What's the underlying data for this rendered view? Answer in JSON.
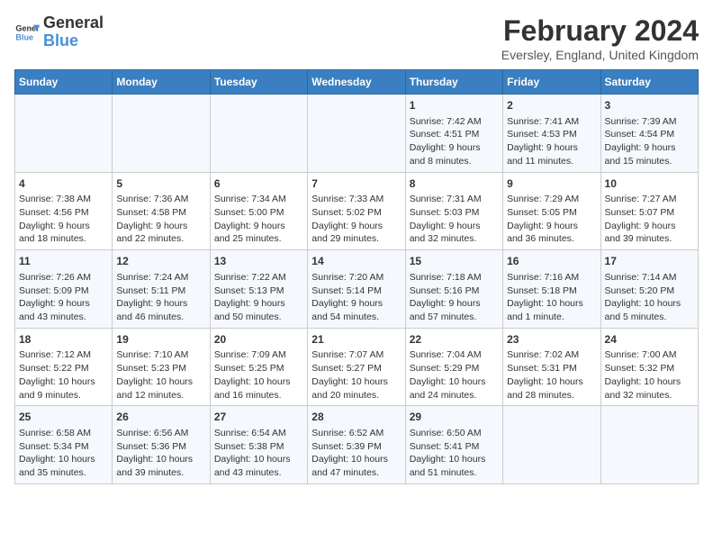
{
  "header": {
    "logo_line1": "General",
    "logo_line2": "Blue",
    "title": "February 2024",
    "subtitle": "Eversley, England, United Kingdom"
  },
  "days_of_week": [
    "Sunday",
    "Monday",
    "Tuesday",
    "Wednesday",
    "Thursday",
    "Friday",
    "Saturday"
  ],
  "weeks": [
    [
      {
        "day": "",
        "info": ""
      },
      {
        "day": "",
        "info": ""
      },
      {
        "day": "",
        "info": ""
      },
      {
        "day": "",
        "info": ""
      },
      {
        "day": "1",
        "info": "Sunrise: 7:42 AM\nSunset: 4:51 PM\nDaylight: 9 hours\nand 8 minutes."
      },
      {
        "day": "2",
        "info": "Sunrise: 7:41 AM\nSunset: 4:53 PM\nDaylight: 9 hours\nand 11 minutes."
      },
      {
        "day": "3",
        "info": "Sunrise: 7:39 AM\nSunset: 4:54 PM\nDaylight: 9 hours\nand 15 minutes."
      }
    ],
    [
      {
        "day": "4",
        "info": "Sunrise: 7:38 AM\nSunset: 4:56 PM\nDaylight: 9 hours\nand 18 minutes."
      },
      {
        "day": "5",
        "info": "Sunrise: 7:36 AM\nSunset: 4:58 PM\nDaylight: 9 hours\nand 22 minutes."
      },
      {
        "day": "6",
        "info": "Sunrise: 7:34 AM\nSunset: 5:00 PM\nDaylight: 9 hours\nand 25 minutes."
      },
      {
        "day": "7",
        "info": "Sunrise: 7:33 AM\nSunset: 5:02 PM\nDaylight: 9 hours\nand 29 minutes."
      },
      {
        "day": "8",
        "info": "Sunrise: 7:31 AM\nSunset: 5:03 PM\nDaylight: 9 hours\nand 32 minutes."
      },
      {
        "day": "9",
        "info": "Sunrise: 7:29 AM\nSunset: 5:05 PM\nDaylight: 9 hours\nand 36 minutes."
      },
      {
        "day": "10",
        "info": "Sunrise: 7:27 AM\nSunset: 5:07 PM\nDaylight: 9 hours\nand 39 minutes."
      }
    ],
    [
      {
        "day": "11",
        "info": "Sunrise: 7:26 AM\nSunset: 5:09 PM\nDaylight: 9 hours\nand 43 minutes."
      },
      {
        "day": "12",
        "info": "Sunrise: 7:24 AM\nSunset: 5:11 PM\nDaylight: 9 hours\nand 46 minutes."
      },
      {
        "day": "13",
        "info": "Sunrise: 7:22 AM\nSunset: 5:13 PM\nDaylight: 9 hours\nand 50 minutes."
      },
      {
        "day": "14",
        "info": "Sunrise: 7:20 AM\nSunset: 5:14 PM\nDaylight: 9 hours\nand 54 minutes."
      },
      {
        "day": "15",
        "info": "Sunrise: 7:18 AM\nSunset: 5:16 PM\nDaylight: 9 hours\nand 57 minutes."
      },
      {
        "day": "16",
        "info": "Sunrise: 7:16 AM\nSunset: 5:18 PM\nDaylight: 10 hours\nand 1 minute."
      },
      {
        "day": "17",
        "info": "Sunrise: 7:14 AM\nSunset: 5:20 PM\nDaylight: 10 hours\nand 5 minutes."
      }
    ],
    [
      {
        "day": "18",
        "info": "Sunrise: 7:12 AM\nSunset: 5:22 PM\nDaylight: 10 hours\nand 9 minutes."
      },
      {
        "day": "19",
        "info": "Sunrise: 7:10 AM\nSunset: 5:23 PM\nDaylight: 10 hours\nand 12 minutes."
      },
      {
        "day": "20",
        "info": "Sunrise: 7:09 AM\nSunset: 5:25 PM\nDaylight: 10 hours\nand 16 minutes."
      },
      {
        "day": "21",
        "info": "Sunrise: 7:07 AM\nSunset: 5:27 PM\nDaylight: 10 hours\nand 20 minutes."
      },
      {
        "day": "22",
        "info": "Sunrise: 7:04 AM\nSunset: 5:29 PM\nDaylight: 10 hours\nand 24 minutes."
      },
      {
        "day": "23",
        "info": "Sunrise: 7:02 AM\nSunset: 5:31 PM\nDaylight: 10 hours\nand 28 minutes."
      },
      {
        "day": "24",
        "info": "Sunrise: 7:00 AM\nSunset: 5:32 PM\nDaylight: 10 hours\nand 32 minutes."
      }
    ],
    [
      {
        "day": "25",
        "info": "Sunrise: 6:58 AM\nSunset: 5:34 PM\nDaylight: 10 hours\nand 35 minutes."
      },
      {
        "day": "26",
        "info": "Sunrise: 6:56 AM\nSunset: 5:36 PM\nDaylight: 10 hours\nand 39 minutes."
      },
      {
        "day": "27",
        "info": "Sunrise: 6:54 AM\nSunset: 5:38 PM\nDaylight: 10 hours\nand 43 minutes."
      },
      {
        "day": "28",
        "info": "Sunrise: 6:52 AM\nSunset: 5:39 PM\nDaylight: 10 hours\nand 47 minutes."
      },
      {
        "day": "29",
        "info": "Sunrise: 6:50 AM\nSunset: 5:41 PM\nDaylight: 10 hours\nand 51 minutes."
      },
      {
        "day": "",
        "info": ""
      },
      {
        "day": "",
        "info": ""
      }
    ]
  ]
}
